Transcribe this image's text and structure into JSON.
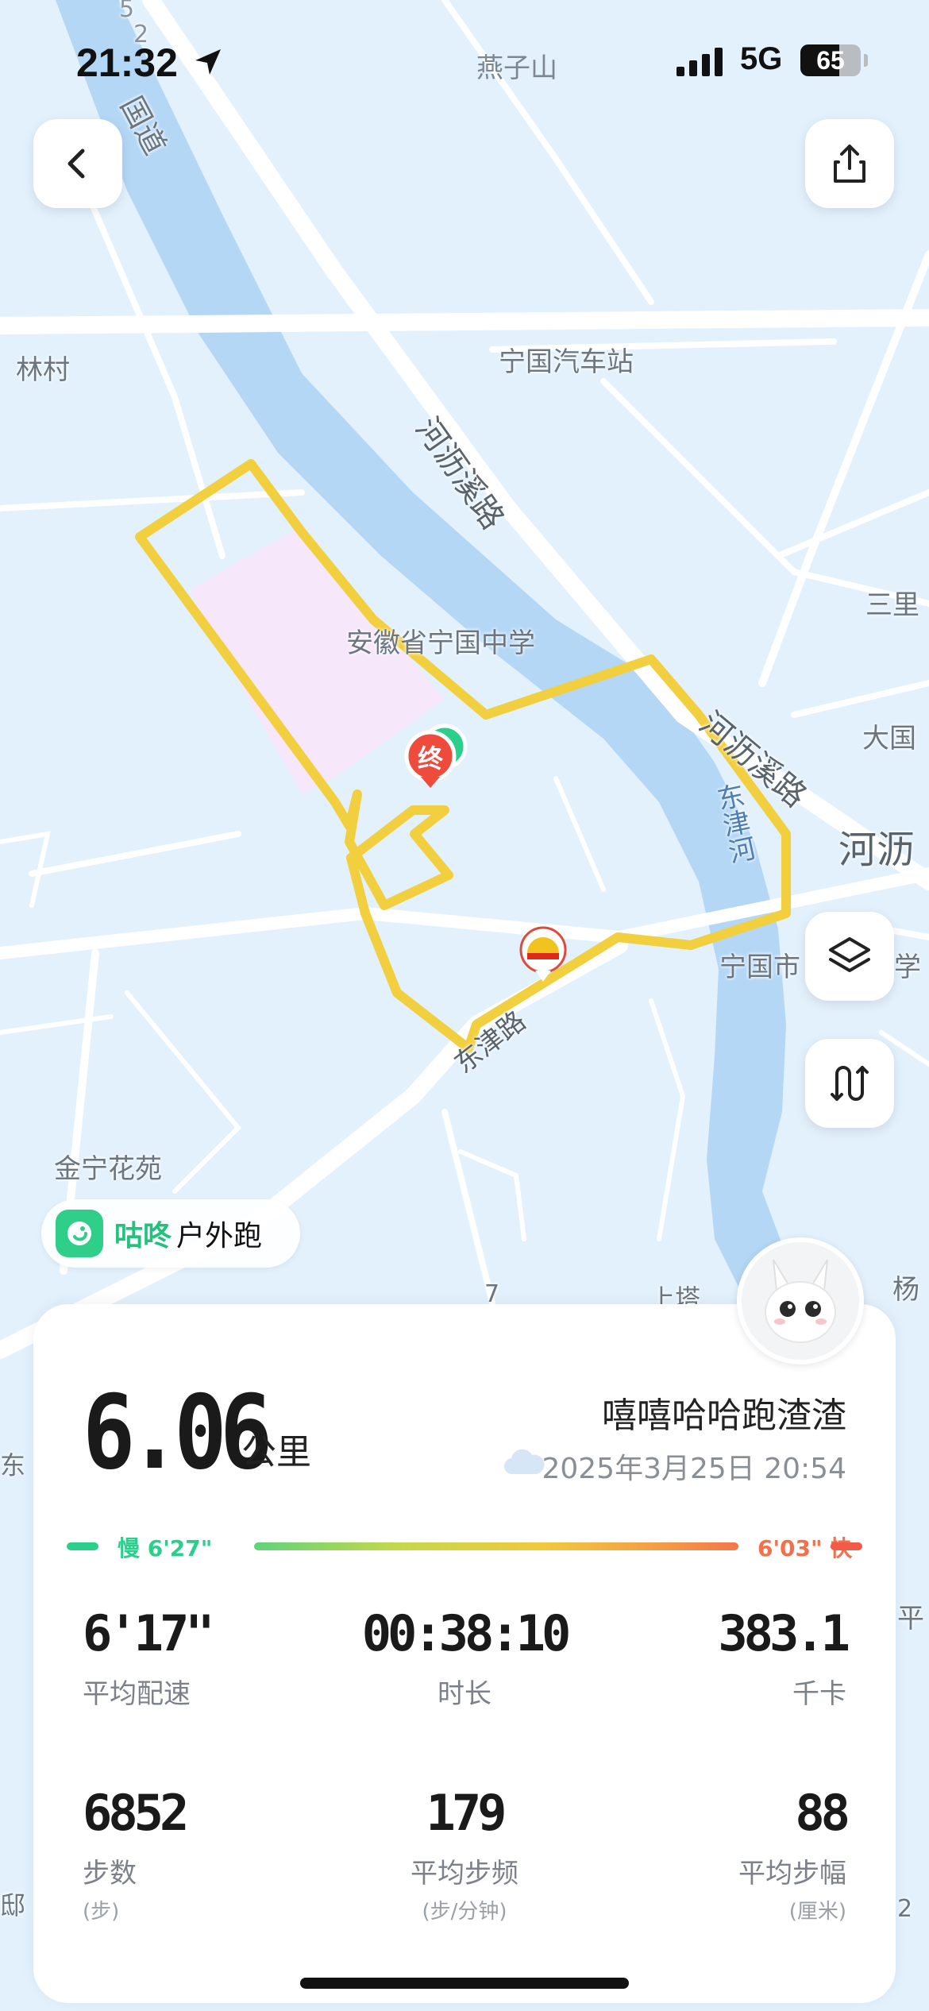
{
  "status_bar": {
    "time": "21:32",
    "location_title": "燕子山",
    "network": "5G",
    "battery": "65"
  },
  "map": {
    "labels": {
      "guodao": "国道",
      "road_num": "5",
      "road_num2": "2",
      "lincun": "林村",
      "ningguo_bus_station": "宁国汽车站",
      "heliqi_road": "河沥溪路",
      "heliqi_road2": "河沥溪路",
      "anhui_school": "安徽省宁国中学",
      "sanli": "三里",
      "daguo": "大国",
      "heli": "河沥",
      "dongjin_river": "东津河",
      "ningguo_school": "宁国市",
      "school_suffix": "学",
      "dongjin_road": "东津路",
      "jinning_garden": "金宁花苑",
      "shangta": "上塔",
      "yang": "杨",
      "ping": "平",
      "dong": "东",
      "di": "邸",
      "num7": "7",
      "num2b": "2"
    },
    "end_marker": "终",
    "route_color": "#f2cf3e",
    "poi_icon": "petrochina-icon"
  },
  "brand": {
    "name": "咕咚",
    "activity": "户外跑"
  },
  "summary": {
    "distance": "6.06",
    "distance_unit": "公里",
    "user_name": "嘻嘻哈哈跑渣渣",
    "datetime": "2025年3月25日 20:54",
    "weather_icon": "cloud-icon",
    "pace_slow": "慢 6'27\"",
    "pace_fast": "6'03\" 快",
    "stats": [
      {
        "value": "6'17\"",
        "label": "平均配速",
        "unit": ""
      },
      {
        "value": "00:38:10",
        "label": "时长",
        "unit": ""
      },
      {
        "value": "383.1",
        "label": "千卡",
        "unit": ""
      },
      {
        "value": "6852",
        "label": "步数",
        "unit": "(步)"
      },
      {
        "value": "179",
        "label": "平均步频",
        "unit": "(步/分钟)"
      },
      {
        "value": "88",
        "label": "平均步幅",
        "unit": "(厘米)"
      }
    ]
  },
  "colors": {
    "accent_green": "#2bcf8b",
    "accent_red": "#f25c47",
    "route": "#f2cf3e",
    "river": "#b4d7f6"
  }
}
